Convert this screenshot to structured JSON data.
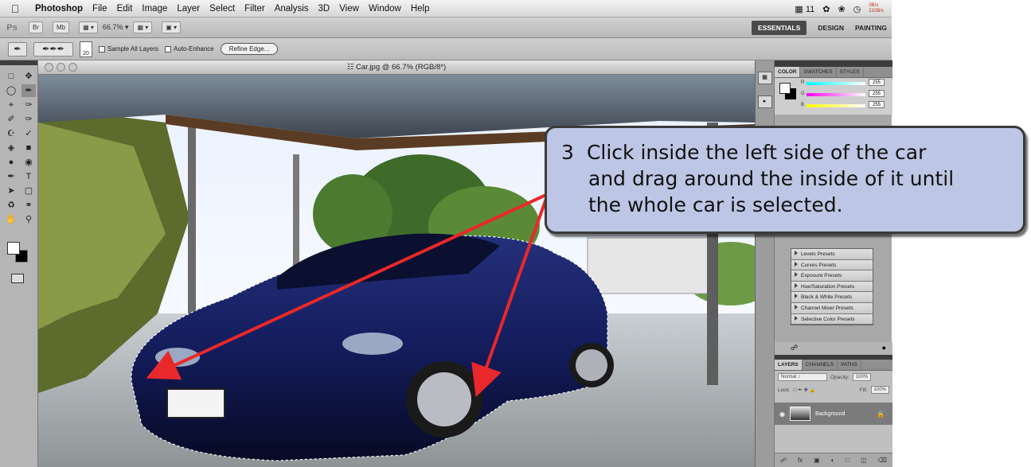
{
  "menubar": {
    "app": "Photoshop",
    "items": [
      "File",
      "Edit",
      "Image",
      "Layer",
      "Select",
      "Filter",
      "Analysis",
      "3D",
      "View",
      "Window",
      "Help"
    ],
    "status_num": "11",
    "net_top": "0B/s",
    "net_bot": "210B/s"
  },
  "appbar": {
    "ps": "Ps",
    "zoom": "66.7%",
    "workspaces": [
      "ESSENTIALS",
      "DESIGN",
      "PAINTING"
    ]
  },
  "options": {
    "brush_size": "20",
    "sample_all_layers": "Sample All Layers",
    "auto_enhance": "Auto-Enhance",
    "refine_edge": "Refine Edge..."
  },
  "document": {
    "title": "Car.jpg @ 66.7% (RGB/8*)"
  },
  "color_panel": {
    "tabs": [
      "COLOR",
      "SWATCHES",
      "STYLES"
    ],
    "channels": [
      {
        "label": "R",
        "value": "255"
      },
      {
        "label": "G",
        "value": "255"
      },
      {
        "label": "B",
        "value": "255"
      }
    ]
  },
  "adjustments": {
    "presets": [
      "Levels Presets",
      "Curves Presets",
      "Exposure Presets",
      "Hue/Saturation Presets",
      "Black & White Presets",
      "Channel Mixer Presets",
      "Selective Color Presets"
    ]
  },
  "layers_panel": {
    "tabs": [
      "LAYERS",
      "CHANNELS",
      "PATHS"
    ],
    "blend_mode": "Normal",
    "opacity_label": "Opacity:",
    "opacity": "100%",
    "lock_label": "Lock:",
    "fill_label": "Fill:",
    "fill": "100%",
    "layer_name": "Background"
  },
  "callout": {
    "number": "3",
    "line1": "Click inside the left side of the car",
    "line2": "and drag around the inside of it until",
    "line3": "the whole car is selected."
  },
  "colors": {
    "callout_bg": "#bdc6e4",
    "arrow": "#e8282a",
    "car": "#141c5c"
  }
}
